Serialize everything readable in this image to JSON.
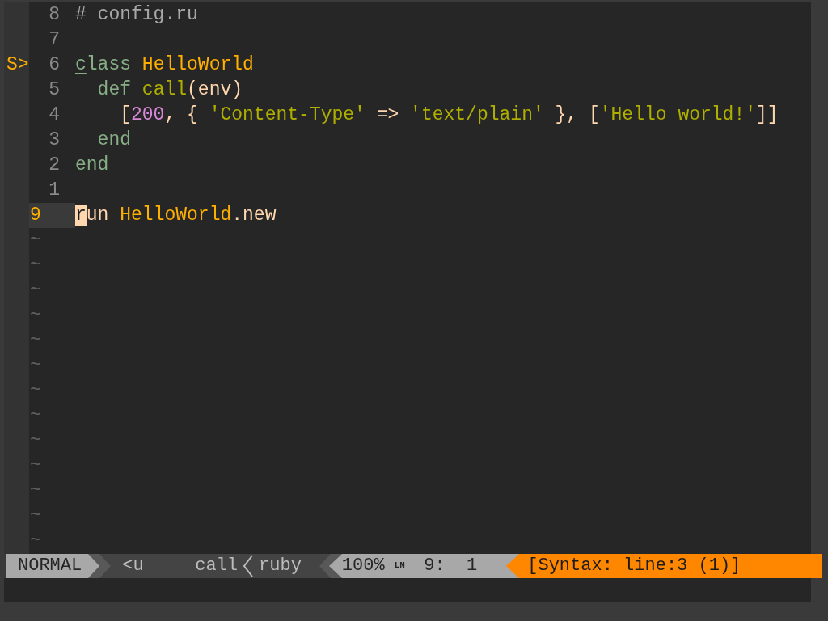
{
  "editor": {
    "lines": [
      {
        "number": "8",
        "current": false,
        "tokens": [
          {
            "text": "# config.ru",
            "kind": "comment"
          }
        ]
      },
      {
        "number": "7",
        "current": false
      },
      {
        "sign": "S>",
        "number": "6",
        "current": false,
        "tokens": [
          {
            "text": "c",
            "kind": "keyword-underlined"
          },
          {
            "text": "lass ",
            "kind": "keyword"
          },
          {
            "text": "HelloWorld",
            "kind": "type"
          }
        ]
      },
      {
        "number": "5",
        "current": false,
        "tokens": [
          {
            "text": "  def ",
            "kind": "keyword"
          },
          {
            "text": "call",
            "kind": "function"
          },
          {
            "text": "(env)",
            "kind": "plain"
          }
        ]
      },
      {
        "number": "4",
        "current": false,
        "tokens": [
          {
            "text": "    [",
            "kind": "plain"
          },
          {
            "text": "200",
            "kind": "number"
          },
          {
            "text": ", { ",
            "kind": "plain"
          },
          {
            "text": "'Content-Type'",
            "kind": "string"
          },
          {
            "text": " => ",
            "kind": "plain"
          },
          {
            "text": "'text/plain'",
            "kind": "string"
          },
          {
            "text": " }, [",
            "kind": "plain"
          },
          {
            "text": "'Hello world!'",
            "kind": "string"
          },
          {
            "text": "]]",
            "kind": "plain"
          }
        ]
      },
      {
        "number": "3",
        "current": false,
        "tokens": [
          {
            "text": "  end",
            "kind": "keyword"
          }
        ]
      },
      {
        "number": "2",
        "current": false,
        "tokens": [
          {
            "text": "end",
            "kind": "keyword"
          }
        ]
      },
      {
        "number": "1",
        "current": false
      },
      {
        "number": "9",
        "current": true,
        "tokens": [
          {
            "text": "r",
            "kind": "cursor"
          },
          {
            "text": "un ",
            "kind": "plain"
          },
          {
            "text": "HelloWorld",
            "kind": "type"
          },
          {
            "text": ".new",
            "kind": "plain"
          }
        ]
      }
    ],
    "filler": [
      "~",
      "~",
      "~",
      "~",
      "~",
      "~",
      "~",
      "~",
      "~",
      "~",
      "~",
      "~",
      "~"
    ]
  },
  "statusline": [
    {
      "text": "NORMAL",
      "kind": "mode"
    },
    {
      "text": "<u",
      "kind": "branch"
    },
    {
      "text": "call",
      "kind": "function"
    },
    {
      "text": "ruby",
      "kind": "filetype"
    },
    {
      "text": "100%",
      "kind": "percent"
    },
    {
      "text": "LN",
      "kind": "ln"
    },
    {
      "text": "9:  1",
      "kind": "position"
    },
    {
      "text": "[Syntax: line:3 (1)]",
      "kind": "warning"
    }
  ]
}
